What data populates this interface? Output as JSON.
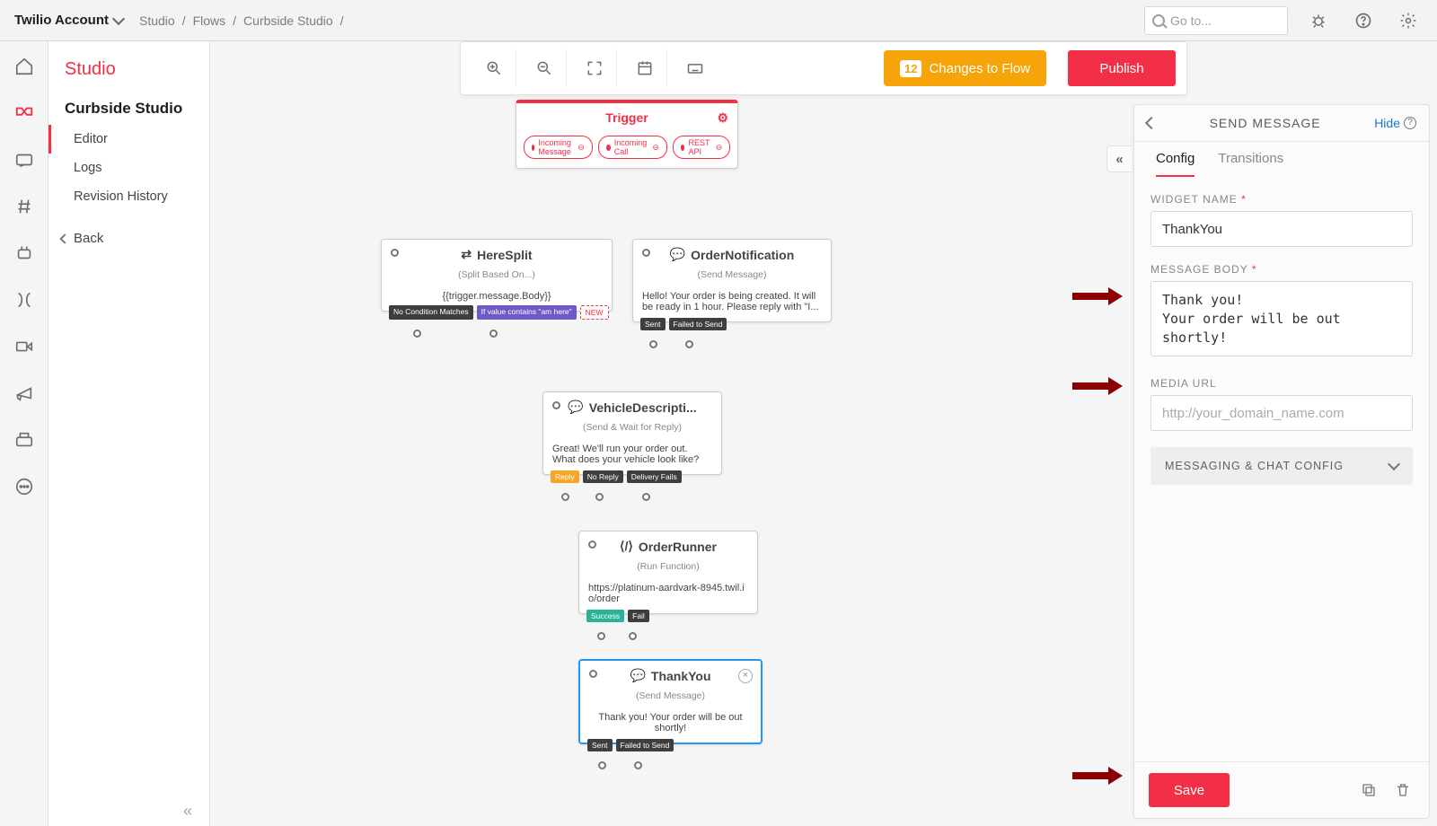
{
  "topbar": {
    "account": "Twilio Account",
    "breadcrumbs": [
      "Studio",
      "Flows",
      "Curbside Studio"
    ],
    "searchPlaceholder": "Go to..."
  },
  "sidebar": {
    "title": "Studio",
    "flowName": "Curbside Studio",
    "items": [
      "Editor",
      "Logs",
      "Revision History"
    ],
    "back": "Back"
  },
  "toolbar": {
    "changesCount": "12",
    "changesLabel": "Changes to Flow",
    "publish": "Publish"
  },
  "nodes": {
    "trigger": {
      "title": "Trigger",
      "pills": [
        "Incoming Message",
        "Incoming Call",
        "REST API"
      ]
    },
    "hereSplit": {
      "title": "HereSplit",
      "sub": "(Split Based On...)",
      "body": "{{trigger.message.Body}}",
      "outs": [
        "No Condition Matches",
        "If value contains \"am here\"",
        "NEW"
      ]
    },
    "orderNotif": {
      "title": "OrderNotification",
      "sub": "(Send Message)",
      "body": "Hello! Your order is being created. It will be ready in 1 hour. Please reply with \"I...",
      "outs": [
        "Sent",
        "Failed to Send"
      ]
    },
    "vehicle": {
      "title": "VehicleDescripti...",
      "sub": "(Send & Wait for Reply)",
      "body": "Great! We'll run your order out. What does your vehicle look like?",
      "outs": [
        "Reply",
        "No Reply",
        "Delivery Fails"
      ]
    },
    "runner": {
      "title": "OrderRunner",
      "sub": "(Run Function)",
      "body": "https://platinum-aardvark-8945.twil.io/order",
      "outs": [
        "Success",
        "Fail"
      ]
    },
    "thankyou": {
      "title": "ThankYou",
      "sub": "(Send Message)",
      "body": "Thank you! Your order will be out shortly!",
      "outs": [
        "Sent",
        "Failed to Send"
      ]
    }
  },
  "panel": {
    "heading": "SEND MESSAGE",
    "hide": "Hide",
    "tabs": [
      "Config",
      "Transitions"
    ],
    "widgetNameLabel": "WIDGET NAME",
    "widgetName": "ThankYou",
    "messageBodyLabel": "MESSAGE BODY",
    "messageBody": "Thank you!\nYour order will be out shortly!",
    "mediaLabel": "MEDIA URL",
    "mediaPlaceholder": "http://your_domain_name.com",
    "accordion": "MESSAGING & CHAT CONFIG",
    "save": "Save"
  }
}
